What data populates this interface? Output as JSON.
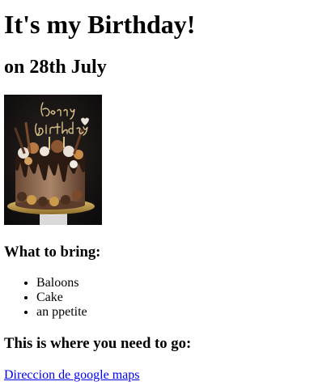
{
  "header": {
    "title": "It's my Birthday!",
    "subtitle": "on 28th July"
  },
  "image": {
    "icon": "birthday-cake-photo",
    "topper_text_line1": "Happy",
    "topper_text_line2": "Birthday"
  },
  "bring": {
    "heading": "What to bring:",
    "items": [
      "Baloons",
      "Cake",
      "an ppetite"
    ]
  },
  "directions": {
    "heading": "This is where you need to go:",
    "link_text": "Direccion de google maps"
  },
  "colors": {
    "link": "#0000ee",
    "text": "#000000",
    "background": "#ffffff"
  }
}
